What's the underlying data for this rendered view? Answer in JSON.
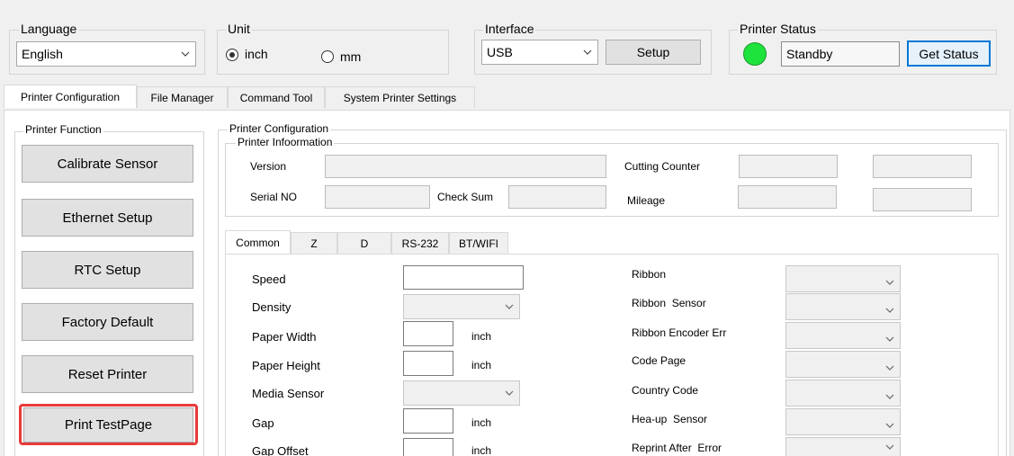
{
  "top": {
    "language": {
      "legend": "Language",
      "value": "English"
    },
    "unit": {
      "legend": "Unit",
      "option_inch": "inch",
      "option_mm": "mm",
      "selected": "inch"
    },
    "interface": {
      "legend": "Interface",
      "value": "USB",
      "setup_label": "Setup"
    },
    "status": {
      "legend": "Printer Status",
      "value": "Standby",
      "get_status_label": "Get Status",
      "indicator_color": "#1fe33d"
    }
  },
  "main_tabs": [
    "Printer Configuration",
    "File Manager",
    "Command Tool",
    "System Printer Settings"
  ],
  "printer_function": {
    "legend": "Printer Function",
    "buttons": [
      "Calibrate Sensor",
      "Ethernet Setup",
      "RTC Setup",
      "Factory Default",
      "Reset Printer",
      "Print TestPage"
    ],
    "highlighted": "Print TestPage",
    "highlight_color": "#e83a3a"
  },
  "config": {
    "legend": "Printer Configuration",
    "info": {
      "legend": "Printer Infoormation",
      "version_label": "Version",
      "cutting_counter_label": "Cutting Counter",
      "serial_label": "Serial NO",
      "checksum_label": "Check Sum",
      "mileage_label": "Mileage"
    },
    "sub_tabs": [
      "Common",
      "Z",
      "D",
      "RS-232",
      "BT/WIFI"
    ],
    "left_rows": [
      {
        "label": "Speed",
        "kind": "text"
      },
      {
        "label": "Density",
        "kind": "combo"
      },
      {
        "label": "Paper Width",
        "kind": "unit",
        "unit": "inch"
      },
      {
        "label": "Paper Height",
        "kind": "unit",
        "unit": "inch"
      },
      {
        "label": "Media Sensor",
        "kind": "combo"
      },
      {
        "label": "Gap",
        "kind": "unit",
        "unit": "inch"
      },
      {
        "label": "Gap Offset",
        "kind": "unit",
        "unit": "inch"
      }
    ],
    "right_rows": [
      "Ribbon",
      "Ribbon  Sensor",
      "Ribbon Encoder Err",
      "Code Page",
      "Country Code",
      "Hea-up  Sensor",
      "Reprint After  Error"
    ]
  }
}
